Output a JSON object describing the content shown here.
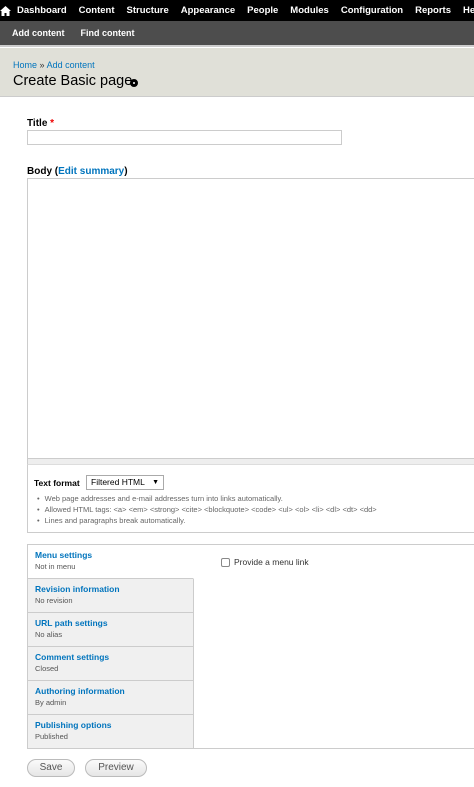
{
  "toolbar": {
    "items": [
      "Dashboard",
      "Content",
      "Structure",
      "Appearance",
      "People",
      "Modules",
      "Configuration",
      "Reports",
      "Help"
    ]
  },
  "shortcuts": [
    "Add content",
    "Find content"
  ],
  "breadcrumb": {
    "home": "Home",
    "separator": "»",
    "current": "Add content"
  },
  "page_title": "Create Basic page",
  "form": {
    "title_label": "Title",
    "required_mark": "*",
    "title_value": "",
    "body_label": "Body",
    "body_summary_link": "Edit summary",
    "body_value": "",
    "text_format_label": "Text format",
    "text_format_selected": "Filtered HTML",
    "text_format_tips": [
      "Web page addresses and e-mail addresses turn into links automatically.",
      "Allowed HTML tags: <a> <em> <strong> <cite> <blockquote> <code> <ul> <ol> <li> <dl> <dt> <dd>",
      "Lines and paragraphs break automatically."
    ]
  },
  "vertical_tabs": [
    {
      "title": "Menu settings",
      "summary": "Not in menu"
    },
    {
      "title": "Revision information",
      "summary": "No revision"
    },
    {
      "title": "URL path settings",
      "summary": "No alias"
    },
    {
      "title": "Comment settings",
      "summary": "Closed"
    },
    {
      "title": "Authoring information",
      "summary": "By admin"
    },
    {
      "title": "Publishing options",
      "summary": "Published"
    }
  ],
  "menu_pane": {
    "checkbox_label": "Provide a menu link",
    "checked": false
  },
  "buttons": {
    "save": "Save",
    "preview": "Preview"
  },
  "colors": {
    "toolbar_bg": "#000000",
    "shortcuts_bg": "#4d4d4d",
    "header_bg": "#e0e0d8",
    "link": "#0074bd",
    "required": "#ee0000"
  },
  "icons": {
    "home": "home-icon",
    "shortcut": "add-shortcut-icon"
  }
}
